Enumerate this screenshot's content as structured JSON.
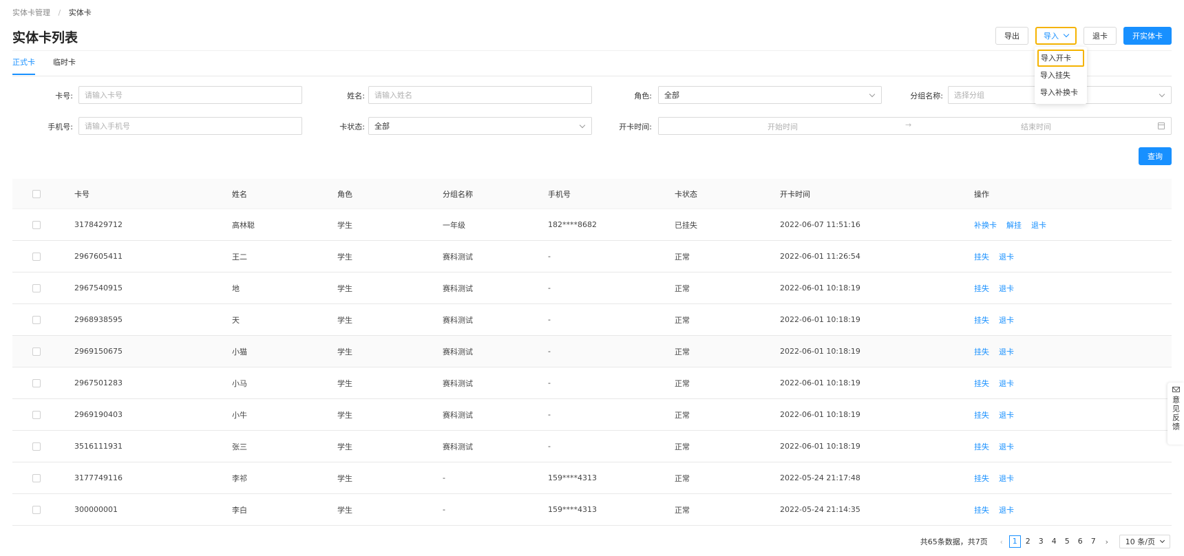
{
  "breadcrumb": {
    "parent": "实体卡管理",
    "separator": "/",
    "current": "实体卡"
  },
  "page_title": "实体卡列表",
  "actions": {
    "export": "导出",
    "import": "导入",
    "return_card": "退卡",
    "open_card": "开实体卡"
  },
  "import_menu": [
    "导入开卡",
    "导入挂失",
    "导入补换卡"
  ],
  "tabs": [
    "正式卡",
    "临时卡"
  ],
  "filters": {
    "card_no": {
      "label": "卡号:",
      "placeholder": "请输入卡号"
    },
    "name": {
      "label": "姓名:",
      "placeholder": "请输入姓名"
    },
    "role": {
      "label": "角色:",
      "value": "全部"
    },
    "group": {
      "label": "分组名称:",
      "placeholder": "选择分组"
    },
    "phone": {
      "label": "手机号:",
      "placeholder": "请输入手机号"
    },
    "status": {
      "label": "卡状态:",
      "value": "全部"
    },
    "open_time": {
      "label": "开卡时间:",
      "start_placeholder": "开始时间",
      "separator": "→",
      "end_placeholder": "结束时间"
    }
  },
  "query_button": "查询",
  "table": {
    "headers": [
      "卡号",
      "姓名",
      "角色",
      "分组名称",
      "手机号",
      "卡状态",
      "开卡时间",
      "操作"
    ],
    "rows": [
      {
        "card": "3178429712",
        "name": "高林聪",
        "role": "学生",
        "group": "一年级",
        "phone": "182****8682",
        "status": "已挂失",
        "time": "2022-06-07 11:51:16",
        "ops": [
          "补换卡",
          "解挂",
          "退卡"
        ]
      },
      {
        "card": "2967605411",
        "name": "王二",
        "role": "学生",
        "group": "赛科测试",
        "phone": "-",
        "status": "正常",
        "time": "2022-06-01 11:26:54",
        "ops": [
          "挂失",
          "退卡"
        ]
      },
      {
        "card": "2967540915",
        "name": "地",
        "role": "学生",
        "group": "赛科测试",
        "phone": "-",
        "status": "正常",
        "time": "2022-06-01 10:18:19",
        "ops": [
          "挂失",
          "退卡"
        ]
      },
      {
        "card": "2968938595",
        "name": "天",
        "role": "学生",
        "group": "赛科测试",
        "phone": "-",
        "status": "正常",
        "time": "2022-06-01 10:18:19",
        "ops": [
          "挂失",
          "退卡"
        ]
      },
      {
        "card": "2969150675",
        "name": "小猫",
        "role": "学生",
        "group": "赛科测试",
        "phone": "-",
        "status": "正常",
        "time": "2022-06-01 10:18:19",
        "ops": [
          "挂失",
          "退卡"
        ]
      },
      {
        "card": "2967501283",
        "name": "小马",
        "role": "学生",
        "group": "赛科测试",
        "phone": "-",
        "status": "正常",
        "time": "2022-06-01 10:18:19",
        "ops": [
          "挂失",
          "退卡"
        ]
      },
      {
        "card": "2969190403",
        "name": "小牛",
        "role": "学生",
        "group": "赛科测试",
        "phone": "-",
        "status": "正常",
        "time": "2022-06-01 10:18:19",
        "ops": [
          "挂失",
          "退卡"
        ]
      },
      {
        "card": "3516111931",
        "name": "张三",
        "role": "学生",
        "group": "赛科测试",
        "phone": "-",
        "status": "正常",
        "time": "2022-06-01 10:18:19",
        "ops": [
          "挂失",
          "退卡"
        ]
      },
      {
        "card": "3177749116",
        "name": "李祁",
        "role": "学生",
        "group": "-",
        "phone": "159****4313",
        "status": "正常",
        "time": "2022-05-24 21:17:48",
        "ops": [
          "挂失",
          "退卡"
        ]
      },
      {
        "card": "300000001",
        "name": "李白",
        "role": "学生",
        "group": "-",
        "phone": "159****4313",
        "status": "正常",
        "time": "2022-05-24 21:14:35",
        "ops": [
          "挂失",
          "退卡"
        ]
      }
    ]
  },
  "pagination": {
    "total_text": "共65条数据，共7页",
    "pages": [
      "1",
      "2",
      "3",
      "4",
      "5",
      "6",
      "7"
    ],
    "current_page": "1",
    "page_size": "10 条/页"
  },
  "feedback": "意见反馈",
  "colors": {
    "primary": "#1890ff",
    "highlight": "#f5b300"
  }
}
